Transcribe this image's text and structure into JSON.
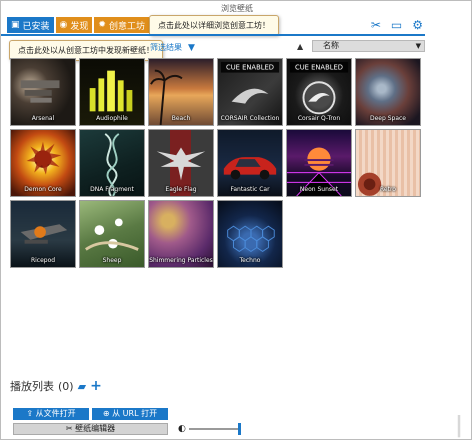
{
  "window": {
    "title": "浏览壁纸"
  },
  "tabs": [
    {
      "label": "已安装",
      "icon": "save-icon"
    },
    {
      "label": "发现",
      "icon": "compass-icon"
    },
    {
      "label": "创意工坊",
      "icon": "workshop-icon"
    }
  ],
  "tooltips": {
    "workshop": "点击此处以详细浏览创意工坊！",
    "discover": "点击此处以从创意工坊中发现新壁纸！"
  },
  "toolbar_icons": [
    "tools-icon",
    "monitor-icon",
    "gear-icon"
  ],
  "filter": {
    "label": "筛选结果",
    "icon": "funnel-icon"
  },
  "sort": {
    "direction_icon": "sort-up-icon",
    "selected": "名称"
  },
  "wallpapers": [
    {
      "name": "Arsenal"
    },
    {
      "name": "Audiophile"
    },
    {
      "name": "Beach"
    },
    {
      "name": "CORSAIR Collection",
      "badge": "CUE ENABLED"
    },
    {
      "name": "Corsair Q-Tron",
      "badge": "CUE ENABLED"
    },
    {
      "name": "Deep Space"
    },
    {
      "name": "Demon Core"
    },
    {
      "name": "DNA Fragment"
    },
    {
      "name": "Eagle Flag"
    },
    {
      "name": "Fantastic Car"
    },
    {
      "name": "Neon Sunset"
    },
    {
      "name": "Retro"
    },
    {
      "name": "Ricepod"
    },
    {
      "name": "Sheep"
    },
    {
      "name": "Shimmering Particles"
    },
    {
      "name": "Techno"
    }
  ],
  "playlist": {
    "label": "播放列表",
    "count": "(0)"
  },
  "buttons": {
    "open_file": "从文件打开",
    "open_url": "从 URL 打开",
    "editor": "壁纸编辑器"
  },
  "brightness": {
    "icon": "brightness-icon",
    "level": 1.0
  },
  "colors": {
    "accent": "#1b78c8",
    "tab_orange": "#e08e1b"
  }
}
